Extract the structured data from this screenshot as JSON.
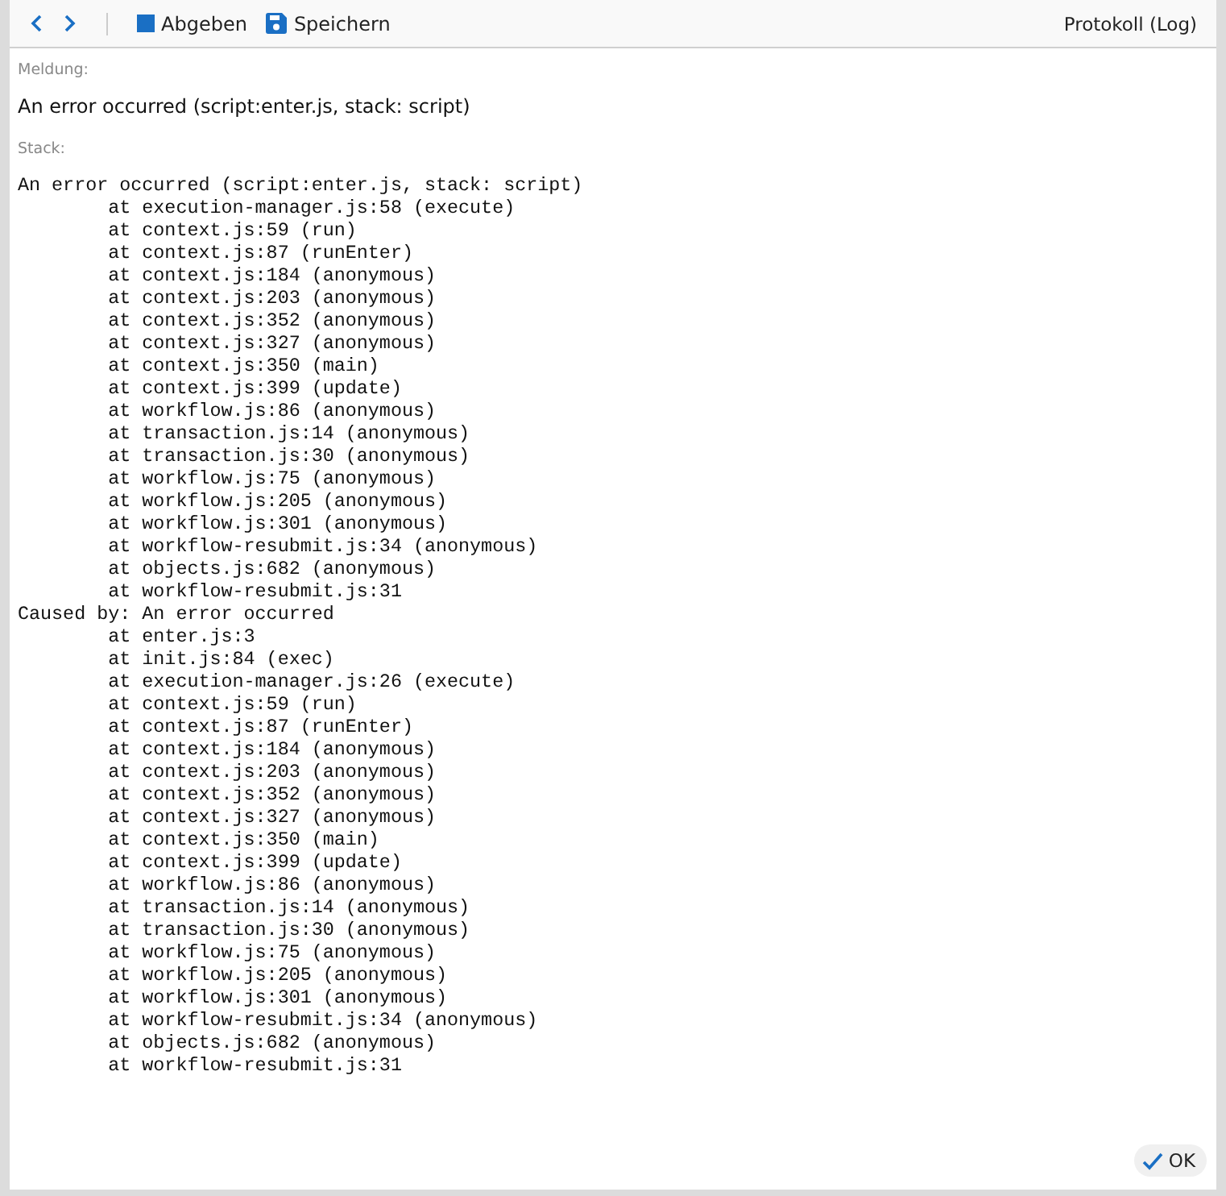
{
  "toolbar": {
    "buttons": [
      {
        "kind": "back"
      },
      {
        "kind": "forward"
      }
    ],
    "actions": [
      {
        "kind": "submit",
        "label": "Abgeben"
      },
      {
        "kind": "save",
        "label": "Speichern"
      }
    ],
    "right_label": "Protokoll (Log)"
  },
  "message": {
    "label": "Meldung:",
    "text": "An error occurred (script:enter.js, stack: script)"
  },
  "stack": {
    "label": "Stack:",
    "text": "An error occurred (script:enter.js, stack: script)\n\tat execution-manager.js:58 (execute)\n\tat context.js:59 (run)\n\tat context.js:87 (runEnter)\n\tat context.js:184 (anonymous)\n\tat context.js:203 (anonymous)\n\tat context.js:352 (anonymous)\n\tat context.js:327 (anonymous)\n\tat context.js:350 (main)\n\tat context.js:399 (update)\n\tat workflow.js:86 (anonymous)\n\tat transaction.js:14 (anonymous)\n\tat transaction.js:30 (anonymous)\n\tat workflow.js:75 (anonymous)\n\tat workflow.js:205 (anonymous)\n\tat workflow.js:301 (anonymous)\n\tat workflow-resubmit.js:34 (anonymous)\n\tat objects.js:682 (anonymous)\n\tat workflow-resubmit.js:31\nCaused by: An error occurred\n\tat enter.js:3\n\tat init.js:84 (exec)\n\tat execution-manager.js:26 (execute)\n\tat context.js:59 (run)\n\tat context.js:87 (runEnter)\n\tat context.js:184 (anonymous)\n\tat context.js:203 (anonymous)\n\tat context.js:352 (anonymous)\n\tat context.js:327 (anonymous)\n\tat context.js:350 (main)\n\tat context.js:399 (update)\n\tat workflow.js:86 (anonymous)\n\tat transaction.js:14 (anonymous)\n\tat transaction.js:30 (anonymous)\n\tat workflow.js:75 (anonymous)\n\tat workflow.js:205 (anonymous)\n\tat workflow.js:301 (anonymous)\n\tat workflow-resubmit.js:34 (anonymous)\n\tat objects.js:682 (anonymous)\n\tat workflow-resubmit.js:31"
  },
  "ok_button": {
    "label": "OK"
  }
}
